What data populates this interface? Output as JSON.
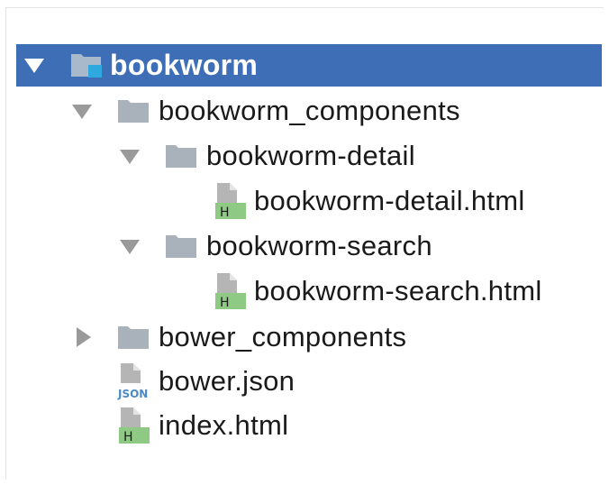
{
  "tree": {
    "root": {
      "label": "bookworm",
      "expanded": true,
      "selected": true,
      "icon": "project-folder-icon"
    },
    "items": [
      {
        "label": "bookworm_components",
        "type": "folder",
        "expanded": true
      },
      {
        "label": "bookworm-detail",
        "type": "folder",
        "expanded": true
      },
      {
        "label": "bookworm-detail.html",
        "type": "file",
        "badge": "H"
      },
      {
        "label": "bookworm-search",
        "type": "folder",
        "expanded": true
      },
      {
        "label": "bookworm-search.html",
        "type": "file",
        "badge": "H"
      },
      {
        "label": "bower_components",
        "type": "folder",
        "expanded": false
      },
      {
        "label": "bower.json",
        "type": "file",
        "badge": "JSON"
      },
      {
        "label": "index.html",
        "type": "file",
        "badge": "H"
      }
    ]
  },
  "colors": {
    "selection": "#3d6eb6",
    "folder": "#a9b1ba",
    "html_badge": "#8fca84",
    "json_badge": "#4a8bc7",
    "arrow": "#9a9a9a"
  }
}
